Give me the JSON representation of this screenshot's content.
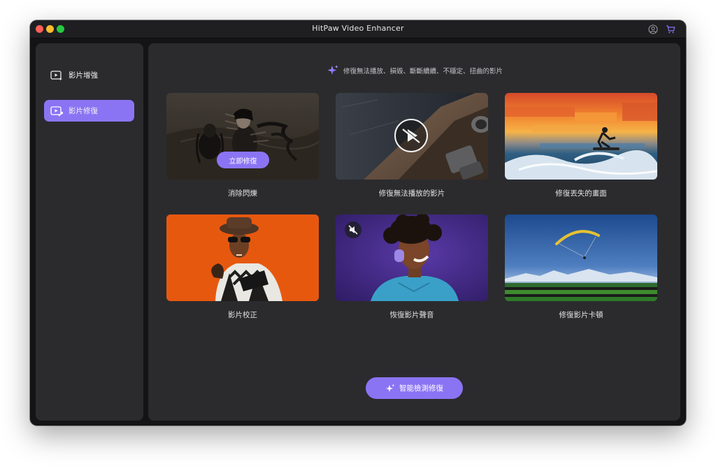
{
  "window": {
    "title": "HitPaw Video Enhancer"
  },
  "titlebar": {
    "icons": [
      "account-icon",
      "cart-icon"
    ]
  },
  "sidebar": {
    "items": [
      {
        "label": "影片增強",
        "icon": "video-enhance-icon",
        "active": false
      },
      {
        "label": "影片修復",
        "icon": "video-repair-icon",
        "active": true
      }
    ]
  },
  "main": {
    "hint": "修復無法播放、損毀、斷斷續續、不穩定、扭曲的影片",
    "hint_icon": "sparkle-icon",
    "cards": [
      {
        "label": "消除閃爍",
        "button": "立即修復"
      },
      {
        "label": "修復無法播放的影片",
        "overlay_icon": "play-icon"
      },
      {
        "label": "修復丟失的畫面"
      },
      {
        "label": "影片校正"
      },
      {
        "label": "恢復影片聲音",
        "overlay_icon": "mute-icon"
      },
      {
        "label": "修復影片卡頓"
      }
    ],
    "smart_button": "智能檢測修復"
  },
  "colors": {
    "accent": "#8b74f4",
    "window_bg": "#141416",
    "panel_bg": "#2b2b2e"
  }
}
